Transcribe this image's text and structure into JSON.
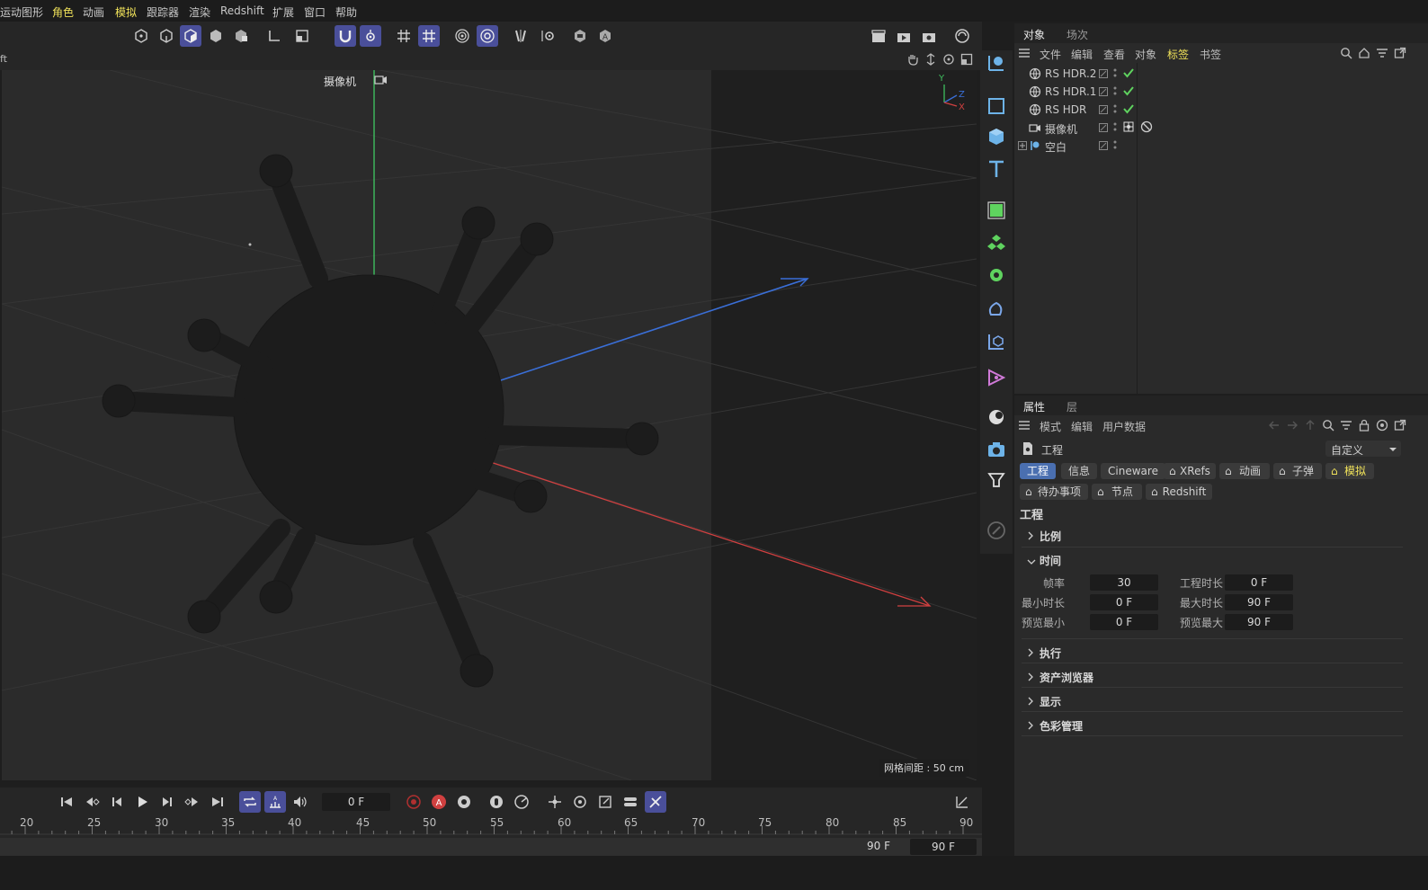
{
  "menu": {
    "items": [
      "运动图形",
      "角色",
      "动画",
      "模拟",
      "跟踪器",
      "渲染",
      "Redshift",
      "扩展",
      "窗口",
      "帮助"
    ],
    "highlighted": [
      "角色",
      "模拟"
    ]
  },
  "viewport": {
    "left_label": "ft",
    "camera_label": "摄像机",
    "grid_label": "网格间距 : 50 cm",
    "axes": {
      "y": "Y",
      "z": "Z",
      "x": "X"
    }
  },
  "objects_panel": {
    "tabs": [
      "对象",
      "场次"
    ],
    "menu": [
      "文件",
      "编辑",
      "查看",
      "对象",
      "标签",
      "书签"
    ],
    "menu_highlight": "标签",
    "rows": [
      {
        "name": "RS HDR.2",
        "icon": "globe-icon",
        "tag": "check"
      },
      {
        "name": "RS HDR.1",
        "icon": "globe-icon",
        "tag": "check"
      },
      {
        "name": "RS HDR",
        "icon": "globe-icon",
        "tag": "check"
      },
      {
        "name": "摄像机",
        "icon": "camera-icon",
        "tag": "target"
      },
      {
        "name": "空白",
        "icon": "null-icon",
        "tag": "none"
      }
    ]
  },
  "attributes_panel": {
    "tabs": [
      "属性",
      "层"
    ],
    "menu": [
      "模式",
      "编辑",
      "用户数据"
    ],
    "title": "工程",
    "preset": "自定义",
    "chips_row1": [
      "工程",
      "信息",
      "Cineware",
      "XRefs",
      "动画",
      "子弹",
      "模拟"
    ],
    "chips_row2": [
      "待办事项",
      "节点",
      "Redshift"
    ],
    "section_title": "工程",
    "groups": [
      "比例",
      "时间",
      "执行",
      "资产浏览器",
      "显示",
      "色彩管理"
    ],
    "time_fields": {
      "fps_label": "帧率",
      "fps": "30",
      "project_len_label": "工程时长",
      "project_len": "0 F",
      "min_label": "最小时长",
      "min": "0 F",
      "max_label": "最大时长",
      "max": "90 F",
      "prev_min_label": "预览最小",
      "prev_min": "0 F",
      "prev_max_label": "预览最大",
      "prev_max": "90 F"
    }
  },
  "timeline": {
    "current_frame": "0 F",
    "ticks": [
      "20",
      "25",
      "30",
      "35",
      "40",
      "45",
      "50",
      "55",
      "60",
      "65",
      "70",
      "75",
      "80",
      "85",
      "90"
    ],
    "end_a": "90 F",
    "end_b": "90 F"
  },
  "colors": {
    "accent": "#4a4f9a",
    "highlight_text": "#f0e25a",
    "check": "#5fd35f",
    "axis_x": "#d04040",
    "axis_y": "#3fbf5f",
    "axis_z": "#3a6fd8"
  }
}
